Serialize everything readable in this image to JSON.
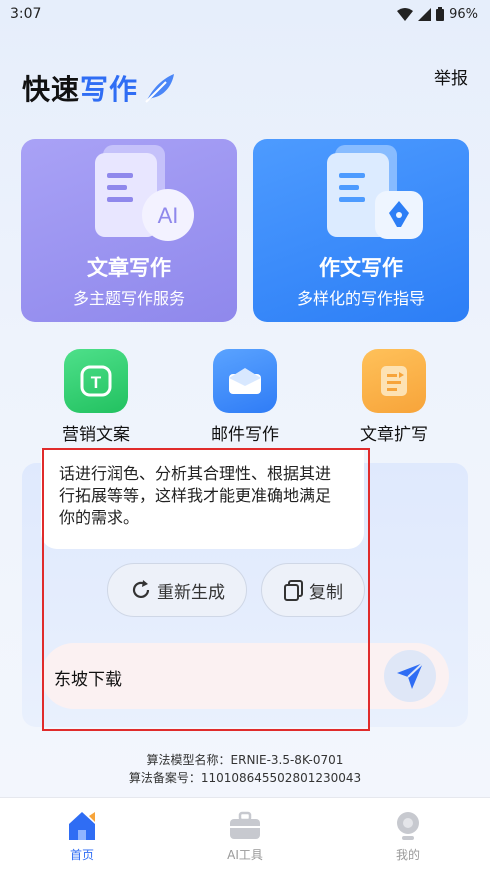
{
  "status": {
    "time": "3:07",
    "battery": "96%"
  },
  "header": {
    "title_part1": "快速",
    "title_part2": "写作",
    "report": "举报"
  },
  "cards": [
    {
      "title": "文章写作",
      "subtitle": "多主题写作服务",
      "badge": "AI"
    },
    {
      "title": "作文写作",
      "subtitle": "多样化的写作指导"
    }
  ],
  "tools": [
    {
      "label": "营销文案",
      "icon_glyph": "T",
      "color": "#2ec96a"
    },
    {
      "label": "邮件写作",
      "color": "#2f7cf6"
    },
    {
      "label": "文章扩写",
      "color": "#f7a43a"
    }
  ],
  "chat": {
    "message": "话进行润色、分析其合理性、根据其进行拓展等等，这样我才能更准确地满足你的需求。",
    "regenerate": "重新生成",
    "copy": "复制",
    "input_value": "东坡下载"
  },
  "footer": {
    "model_line": "算法模型名称：ERNIE-3.5-8K-0701",
    "record_line": "算法备案号：110108645502801230043"
  },
  "tabbar": {
    "home": "首页",
    "ai_tools": "AI工具",
    "mine": "我的",
    "active_color": "#2f6df4"
  }
}
